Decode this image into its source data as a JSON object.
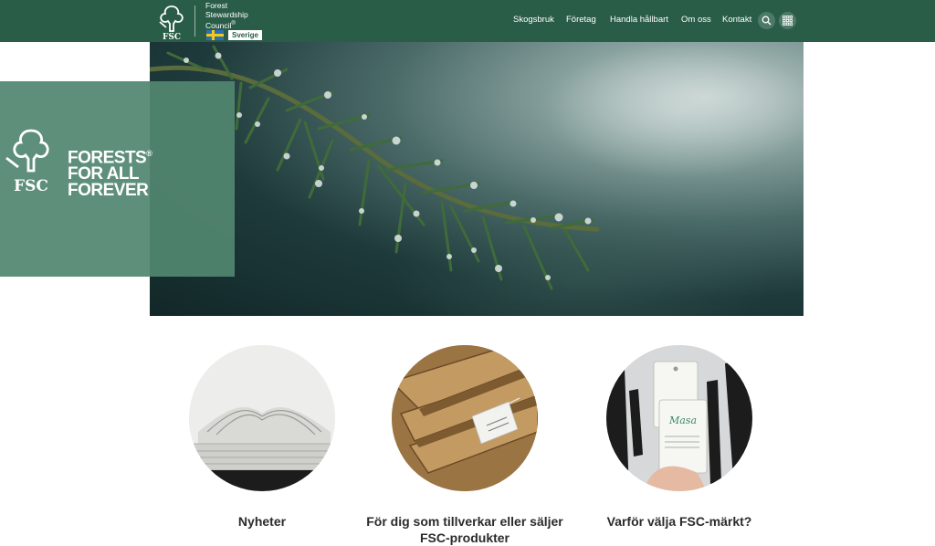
{
  "header": {
    "org_name_line1": "Forest",
    "org_name_line2": "Stewardship",
    "org_name_line3": "Council",
    "country": "Sverige",
    "logo_text": "FSC",
    "nav": [
      "Skogsbruk",
      "Företag",
      "Handla hållbart",
      "Om oss",
      "Kontakt"
    ],
    "brand_color": "#2a5d48"
  },
  "hero": {
    "tagline_line1": "FORESTS",
    "tagline_line2": "FOR ALL",
    "tagline_line3": "FOREVER",
    "logo_text": "FSC"
  },
  "cards": [
    {
      "title": "Nyheter"
    },
    {
      "title": "För dig som tillverkar eller säljer FSC-produkter"
    },
    {
      "title": "Varför välja FSC-märkt?"
    }
  ]
}
